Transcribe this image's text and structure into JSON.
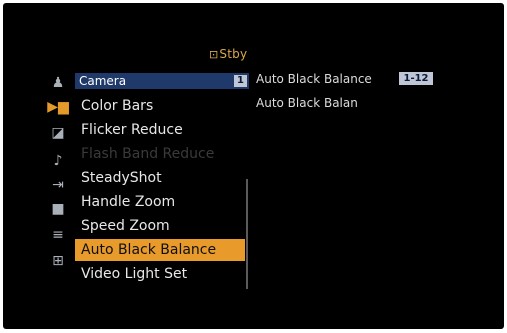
{
  "status": {
    "icon": "tape-standby-icon",
    "text": "Stby",
    "color": "#d9a84a"
  },
  "category": {
    "label": "Camera",
    "page": "1",
    "bar_color": "#1f3a6a"
  },
  "sidebar_icons": [
    "person-icon",
    "camera-icon",
    "scene-icon",
    "music-note-icon",
    "export-icon",
    "display-icon",
    "settings-sliders-icon",
    "clock-icon"
  ],
  "menu": {
    "items": [
      {
        "label": "Color Bars"
      },
      {
        "label": "Flicker Reduce"
      },
      {
        "label": "Flash Band Reduce"
      },
      {
        "label": "SteadyShot"
      },
      {
        "label": "Handle Zoom"
      },
      {
        "label": "Speed Zoom"
      },
      {
        "label": "Auto Black Balance"
      },
      {
        "label": "Video Light Set"
      }
    ],
    "selected_index": 6,
    "selected_color": "#e89a2a"
  },
  "detail": {
    "title": "Auto Black Balance",
    "range": "1-12",
    "subtitle": "Auto Black Balan"
  }
}
